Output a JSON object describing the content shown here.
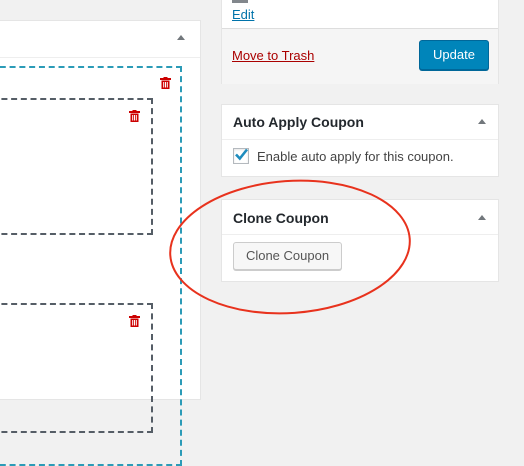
{
  "publish": {
    "edit_link": "Edit",
    "move_to_trash": "Move to Trash",
    "update_button": "Update"
  },
  "auto_apply": {
    "title": "Auto Apply Coupon",
    "checkbox_checked": true,
    "checkbox_label": "Enable auto apply for this coupon."
  },
  "clone": {
    "title": "Clone Coupon",
    "button_label": "Clone Coupon"
  },
  "colors": {
    "primary": "#0085ba",
    "trash_red": "#a00",
    "highlight_circle": "#e8321d",
    "dashed_outer": "#2b9bb7"
  }
}
